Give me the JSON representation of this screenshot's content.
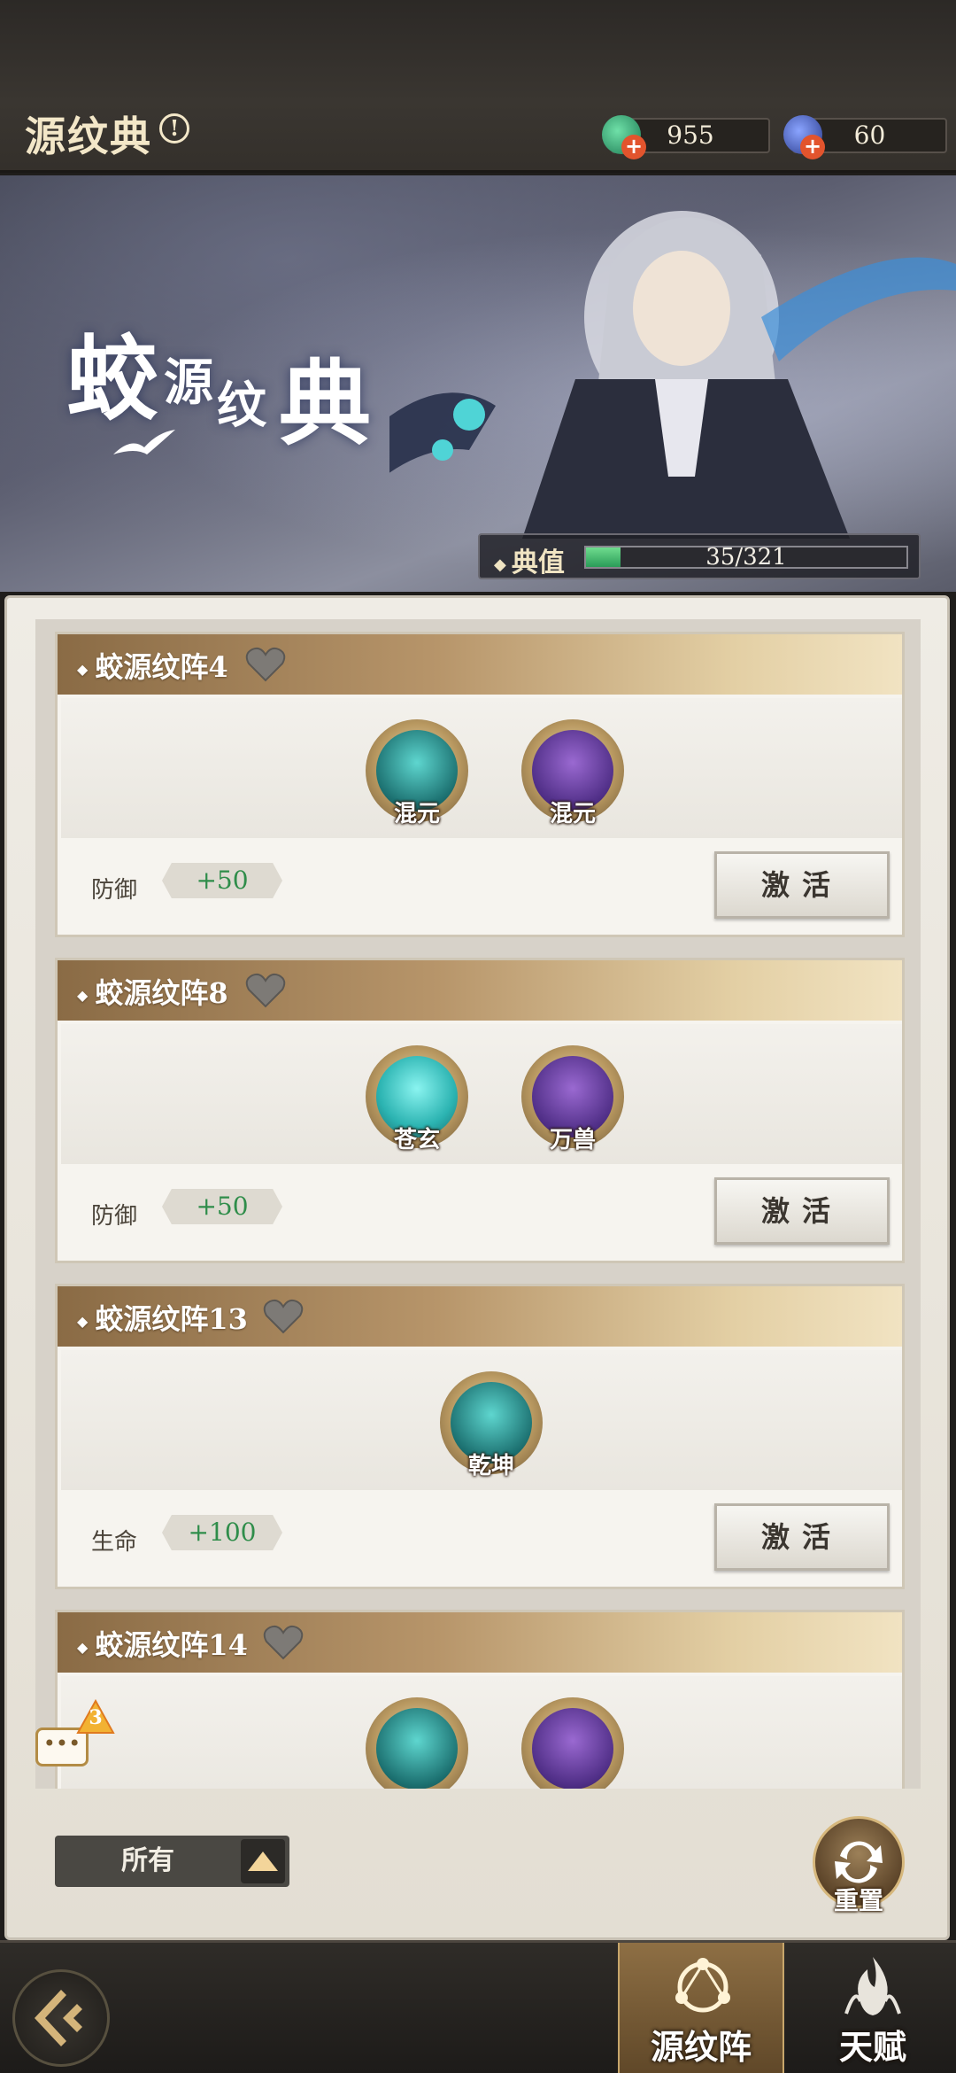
{
  "header": {
    "title": "源纹典",
    "info_symbol": "!",
    "currencies": [
      {
        "icon": "jade-coin-icon",
        "value": "955",
        "plus": "+"
      },
      {
        "icon": "blue-orb-icon",
        "value": "60",
        "plus": "+"
      }
    ]
  },
  "banner": {
    "title_chars": [
      "蛟",
      "源",
      "纹",
      "典"
    ],
    "progress": {
      "label": "典值",
      "current": 35,
      "max": 321,
      "text": "35/321",
      "fraction": 0.109
    }
  },
  "cards": [
    {
      "title": "蛟源纹阵4",
      "gems": [
        {
          "label": "混元",
          "color": "teal"
        },
        {
          "label": "混元",
          "color": "purple"
        }
      ],
      "stat_label": "防御",
      "stat_value": "+50",
      "button": "激活"
    },
    {
      "title": "蛟源纹阵8",
      "gems": [
        {
          "label": "苍玄",
          "color": "tealbright"
        },
        {
          "label": "万兽",
          "color": "purple"
        }
      ],
      "stat_label": "防御",
      "stat_value": "+50",
      "button": "激活"
    },
    {
      "title": "蛟源纹阵13",
      "gems": [
        {
          "label": "乾坤",
          "color": "teal"
        }
      ],
      "stat_label": "生命",
      "stat_value": "+100",
      "button": "激活"
    },
    {
      "title": "蛟源纹阵14",
      "gems": [
        {
          "label": "",
          "color": "teal"
        },
        {
          "label": "",
          "color": "purple"
        }
      ]
    }
  ],
  "chat": {
    "icon": "chat-bubble-icon",
    "text": "•••",
    "badge": "3"
  },
  "filter": {
    "label": "所有",
    "icon": "triangle-up-icon"
  },
  "reset": {
    "label": "重置",
    "icon": "refresh-icon"
  },
  "bottom_nav": {
    "back_icon": "back-arrow-icon",
    "tabs": [
      {
        "label": "源纹阵",
        "icon": "formation-icon",
        "active": true
      },
      {
        "label": "天赋",
        "icon": "flame-icon",
        "active": false
      }
    ]
  },
  "colors": {
    "accent_gold": "#b7956a",
    "stat_green": "#2f8d4a",
    "progress_green": "#2a9c58"
  }
}
